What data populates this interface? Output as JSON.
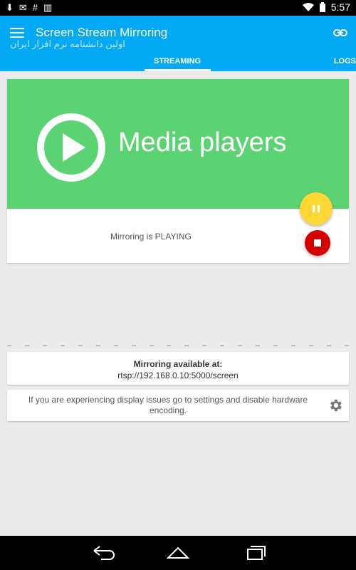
{
  "status_bar": {
    "time": "5:57"
  },
  "app_bar": {
    "title": "Screen Stream Mirroring",
    "watermark": "اولین دانشنامه نرم افزار ایران",
    "tabs": [
      {
        "label": "STREAMING",
        "active": true
      },
      {
        "label": "LOGS",
        "active": false
      }
    ]
  },
  "media": {
    "banner_text": "Media players",
    "state_text": "Mirroring is PLAYING",
    "banner_color": "#5bd373"
  },
  "info": {
    "line1": "Mirroring available at:",
    "line2": "rtsp://192.168.0.10:5000/screen"
  },
  "tip": {
    "text": "If you are experiencing display issues go to settings and disable hardware encoding."
  },
  "colors": {
    "app_bar": "#03a9f4",
    "pause": "#fdd835",
    "stop": "#d50000"
  }
}
